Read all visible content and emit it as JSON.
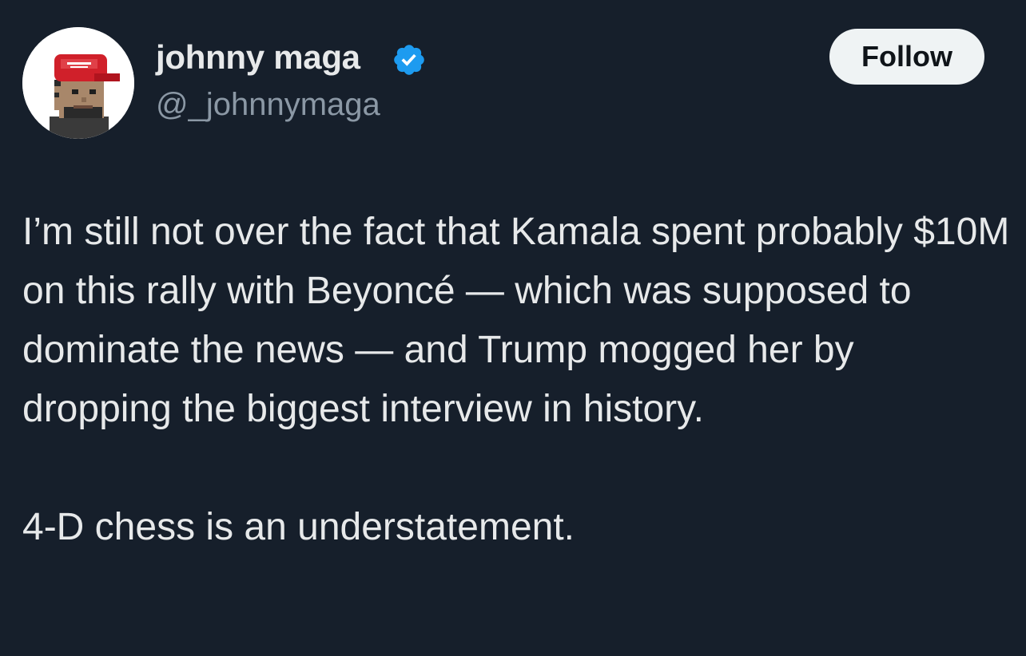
{
  "author": {
    "display_name": "johnny maga",
    "handle": "@_johnnymaga",
    "verified": true,
    "avatar_icon": "pixel-avatar-red-cap-icon"
  },
  "actions": {
    "follow_label": "Follow"
  },
  "tweet": {
    "paragraph_1": "I’m still not over the fact that Kamala spent probably $10M on this rally with Beyoncé — which was supposed to dominate the news — and Trump mogged her by dropping the biggest interview in history.",
    "paragraph_2": "4-D chess is an understatement."
  },
  "colors": {
    "background": "#161f2b",
    "text": "#e7e9ea",
    "secondary_text": "#8b98a5",
    "verified_blue": "#1d9bf0",
    "follow_bg": "#eff3f4"
  }
}
